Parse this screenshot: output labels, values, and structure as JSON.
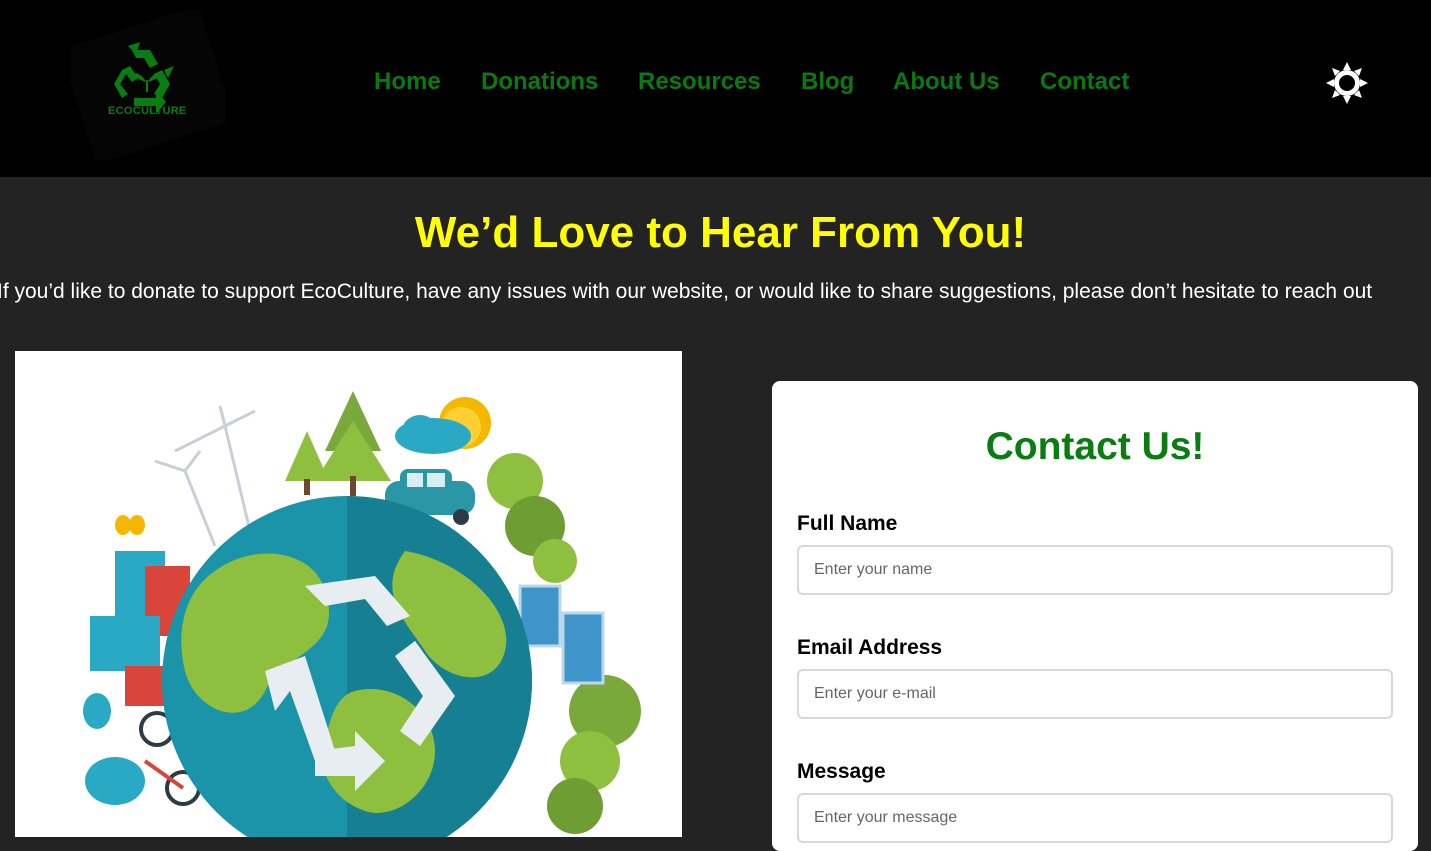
{
  "header": {
    "logo_text": "ECOCULTURE",
    "nav": [
      "Home",
      "Donations",
      "Resources",
      "Blog",
      "About Us",
      "Contact"
    ]
  },
  "hero": {
    "title": "We’d Love to Hear From You!",
    "subtitle": "If you’d like to donate to support EcoCulture, have any issues with our website, or would like to share suggestions, please don’t hesitate to reach out"
  },
  "contact": {
    "title": "Contact Us!",
    "name_label": "Full Name",
    "name_placeholder": "Enter your name",
    "email_label": "Email Address",
    "email_placeholder": "Enter your e-mail",
    "message_label": "Message",
    "message_placeholder": "Enter your message"
  },
  "colors": {
    "header_bg": "#000000",
    "page_bg": "#232323",
    "nav_text": "#0a7a10",
    "hero_title": "#ffff00",
    "accent_green": "#0a7d12"
  },
  "icons": {
    "logo": "recycle-icon",
    "theme_toggle": "sun-icon"
  }
}
